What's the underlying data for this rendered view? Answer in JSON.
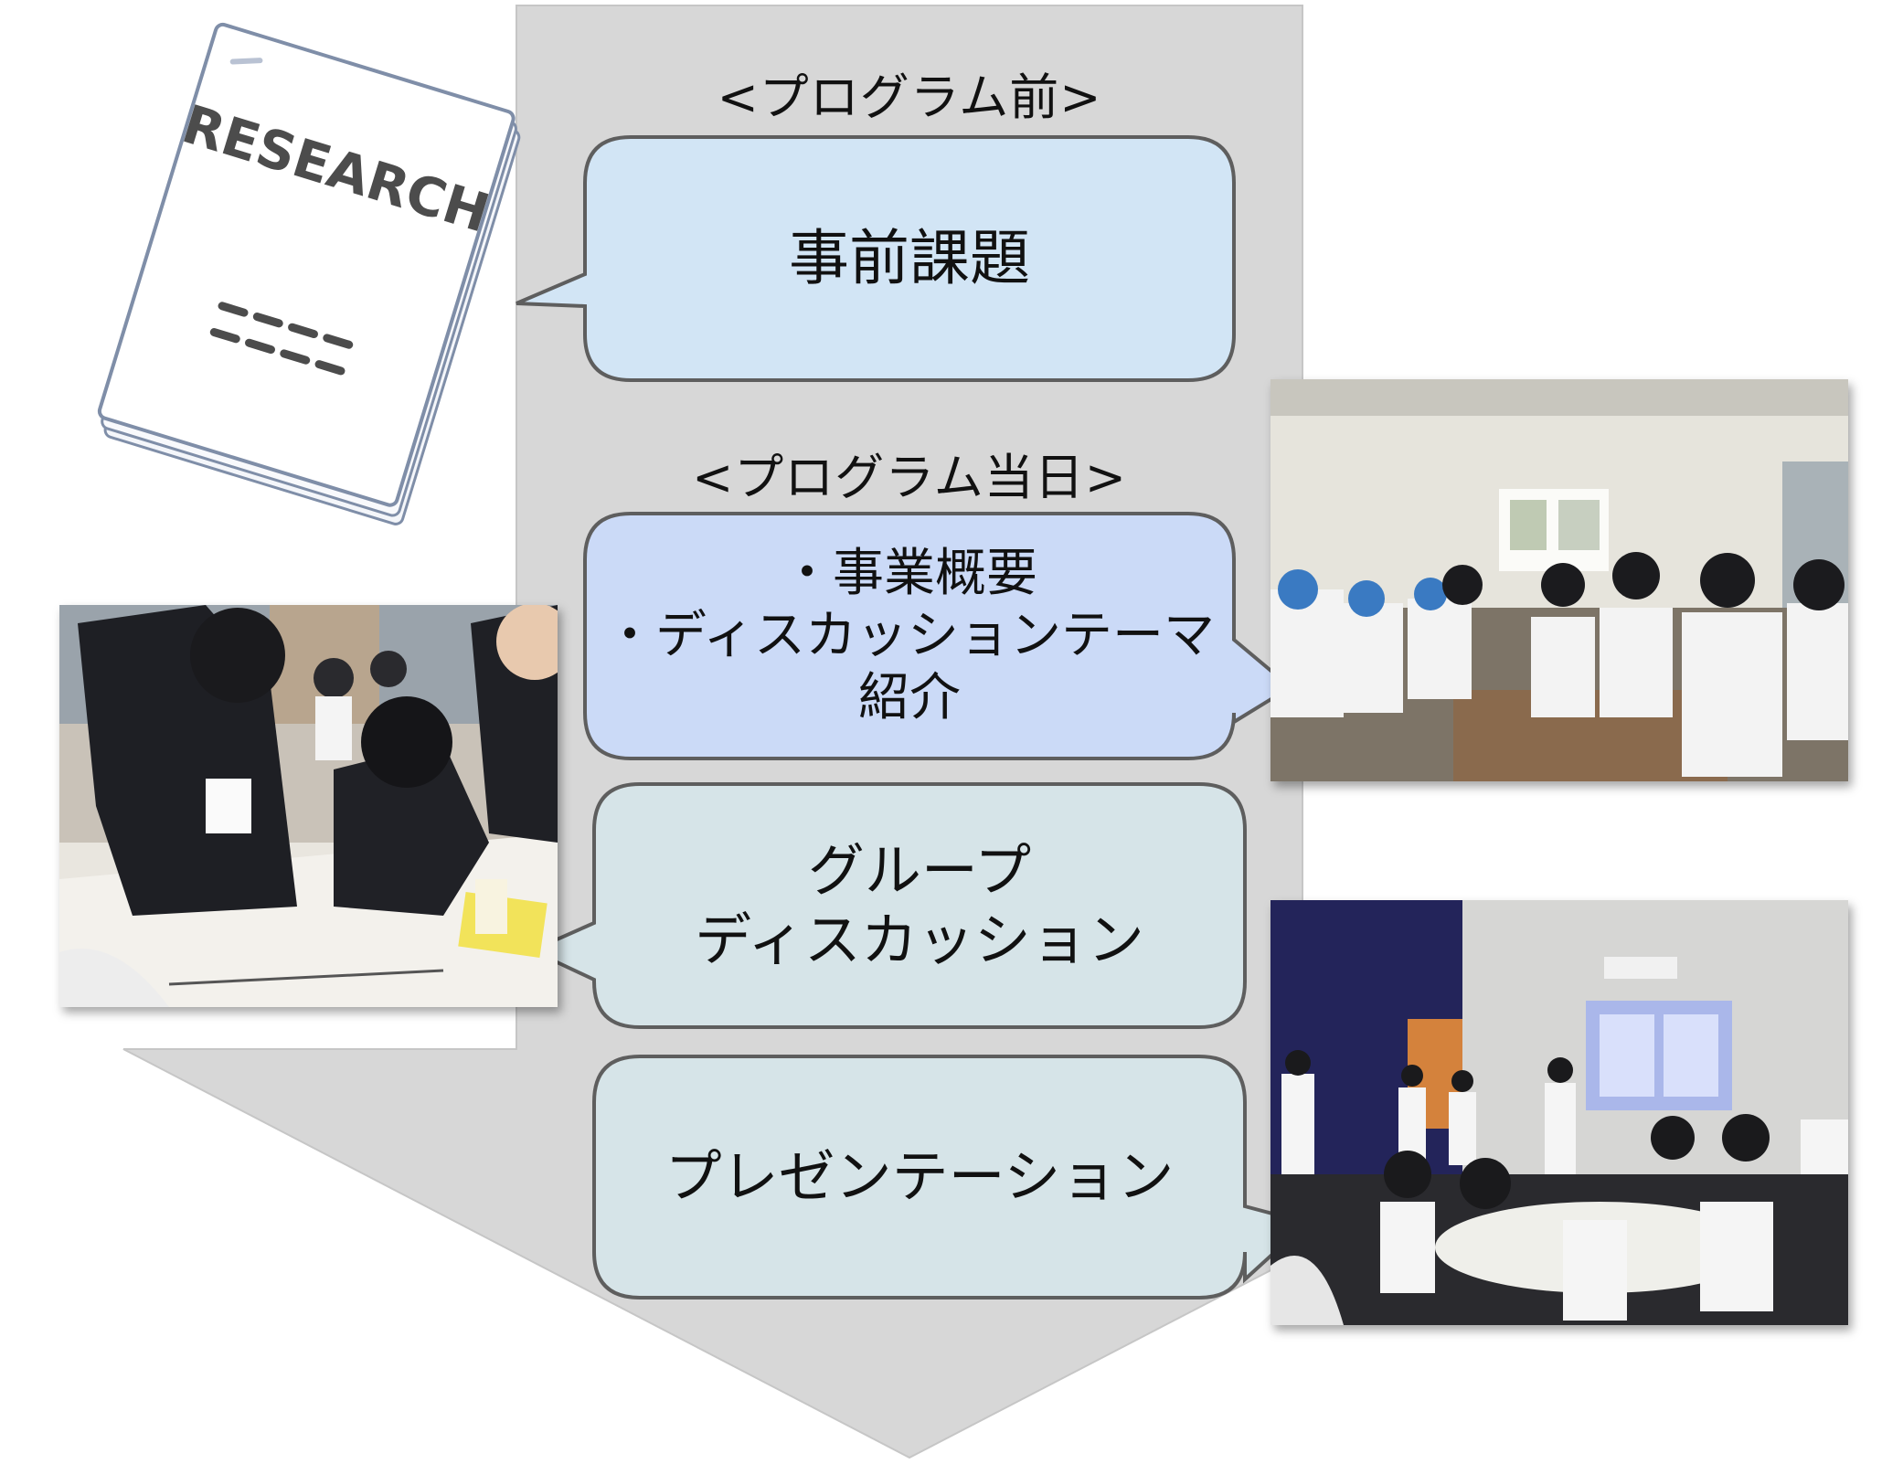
{
  "phases": {
    "before": "<プログラム前>",
    "day": "<プログラム当日>"
  },
  "document": {
    "title": "RESEARCH"
  },
  "steps": {
    "pre_task": {
      "label": "事前課題",
      "color": "#d2e5f5"
    },
    "overview": {
      "line1": "・事業概要",
      "line2": "・ディスカッションテーマ",
      "line3": "紹介",
      "color": "#cbdaf7"
    },
    "group": {
      "line1": "グループ",
      "line2": "ディスカッション",
      "color": "#d6e4e8"
    },
    "presentation": {
      "label": "プレゼンテーション",
      "color": "#d6e4e8"
    }
  },
  "colors": {
    "arrow": "#d7d7d7",
    "bubble_border": "#5e5e5e"
  }
}
